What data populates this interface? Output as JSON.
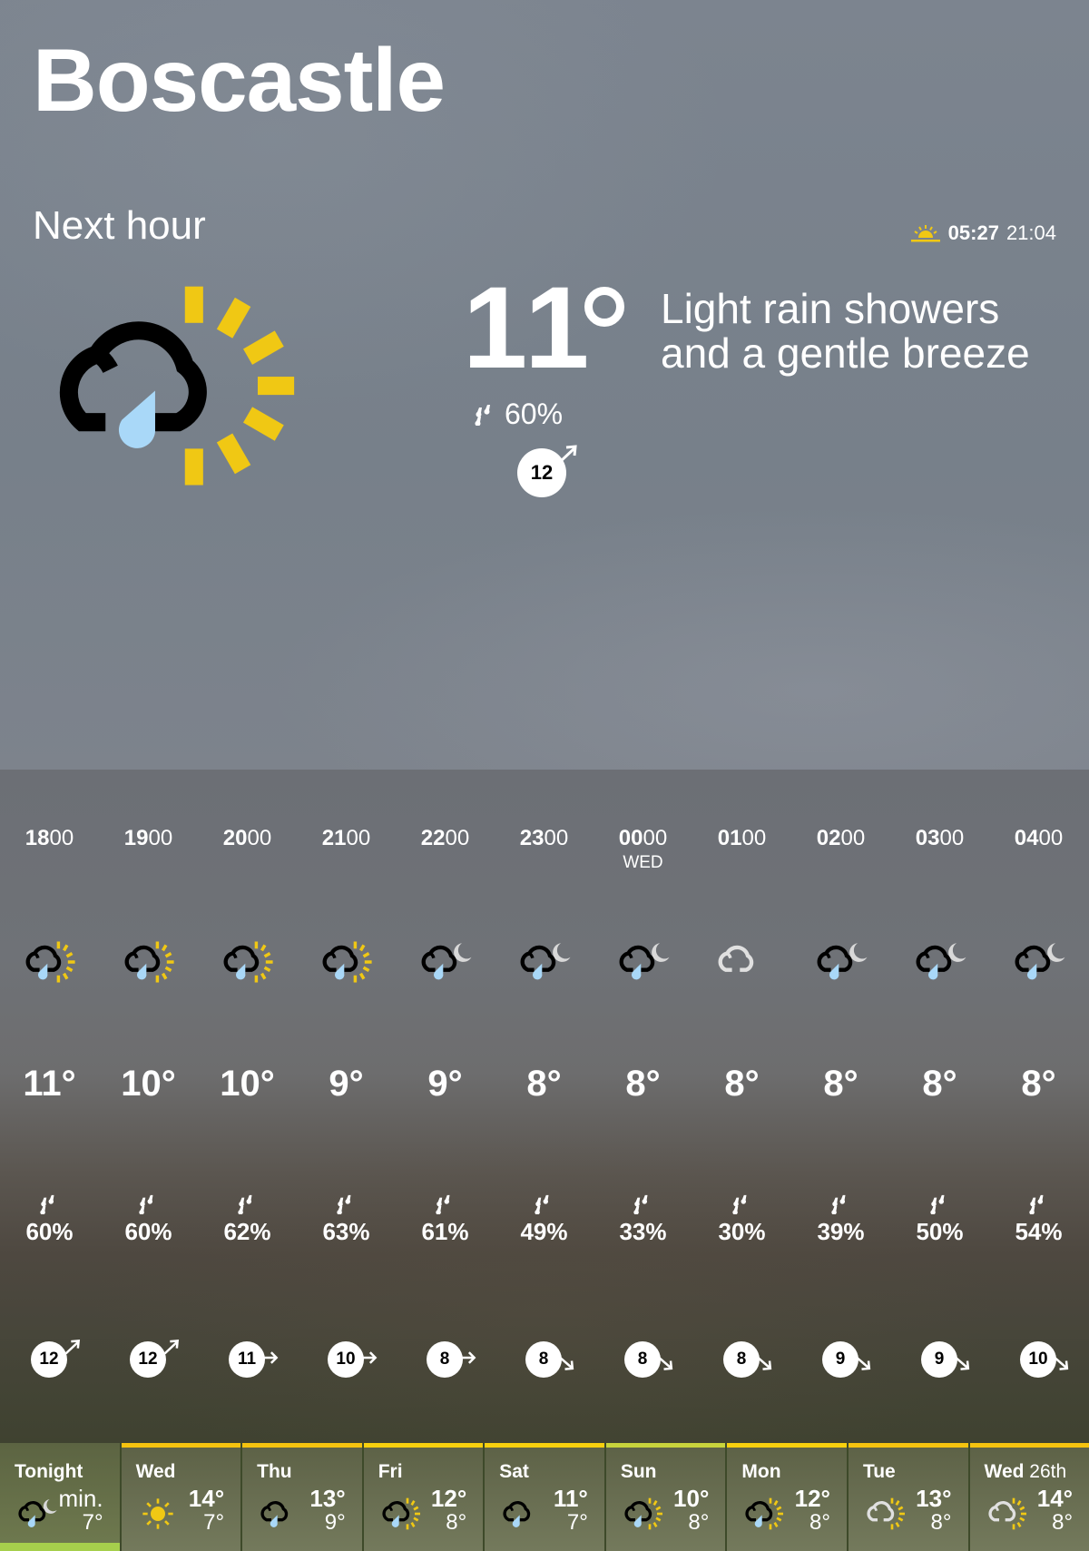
{
  "location": "Boscastle",
  "next_hour": {
    "label": "Next hour",
    "icon": "light-rain-shower-day-icon",
    "temperature": "11",
    "description_line1": "Light rain showers",
    "description_line2": "and a gentle breeze",
    "rain_chance": "60%",
    "wind_speed": "12",
    "wind_direction": "south-west"
  },
  "sun": {
    "icon": "sunrise-icon",
    "sunrise": "05:27",
    "sunset": "21:04"
  },
  "hourly": [
    {
      "hour": "18",
      "min": "00",
      "day": "",
      "icon": "light-rain-shower-day-icon",
      "temp": "11°",
      "rain": "60%",
      "wind": "12",
      "dir": "sw"
    },
    {
      "hour": "19",
      "min": "00",
      "day": "",
      "icon": "light-rain-shower-day-icon",
      "temp": "10°",
      "rain": "60%",
      "wind": "12",
      "dir": "sw"
    },
    {
      "hour": "20",
      "min": "00",
      "day": "",
      "icon": "light-rain-shower-day-icon",
      "temp": "10°",
      "rain": "62%",
      "wind": "11",
      "dir": "w"
    },
    {
      "hour": "21",
      "min": "00",
      "day": "",
      "icon": "light-rain-shower-day-icon",
      "temp": "9°",
      "rain": "63%",
      "wind": "10",
      "dir": "w"
    },
    {
      "hour": "22",
      "min": "00",
      "day": "",
      "icon": "light-rain-shower-night-icon",
      "temp": "9°",
      "rain": "61%",
      "wind": "8",
      "dir": "w"
    },
    {
      "hour": "23",
      "min": "00",
      "day": "",
      "icon": "light-rain-shower-night-icon",
      "temp": "8°",
      "rain": "49%",
      "wind": "8",
      "dir": "nw"
    },
    {
      "hour": "00",
      "min": "00",
      "day": "WED",
      "icon": "light-rain-shower-night-icon",
      "temp": "8°",
      "rain": "33%",
      "wind": "8",
      "dir": "nw"
    },
    {
      "hour": "01",
      "min": "00",
      "day": "",
      "icon": "light-cloud-icon",
      "temp": "8°",
      "rain": "30%",
      "wind": "8",
      "dir": "nw"
    },
    {
      "hour": "02",
      "min": "00",
      "day": "",
      "icon": "light-rain-shower-night-icon",
      "temp": "8°",
      "rain": "39%",
      "wind": "9",
      "dir": "nw"
    },
    {
      "hour": "03",
      "min": "00",
      "day": "",
      "icon": "light-rain-shower-night-icon",
      "temp": "8°",
      "rain": "50%",
      "wind": "9",
      "dir": "nw"
    },
    {
      "hour": "04",
      "min": "00",
      "day": "",
      "icon": "light-rain-shower-night-icon",
      "temp": "8°",
      "rain": "54%",
      "wind": "10",
      "dir": "nw"
    }
  ],
  "daily": [
    {
      "name": "Tonight",
      "suffix": "",
      "icon": "light-rain-shower-night-icon",
      "hi": "",
      "min_label": "min.",
      "lo": "7°",
      "bar": "#a6cf4c",
      "bar_pos": "bottom"
    },
    {
      "name": "Wed",
      "suffix": "",
      "icon": "sunny-icon",
      "hi": "14°",
      "lo": "7°",
      "bar": "#f5c30f"
    },
    {
      "name": "Thu",
      "suffix": "",
      "icon": "light-rain-icon",
      "hi": "13°",
      "lo": "9°",
      "bar": "#f5c30f"
    },
    {
      "name": "Fri",
      "suffix": "",
      "icon": "light-rain-shower-day-icon",
      "hi": "12°",
      "lo": "8°",
      "bar": "#f7d00e"
    },
    {
      "name": "Sat",
      "suffix": "",
      "icon": "light-rain-icon",
      "hi": "11°",
      "lo": "7°",
      "bar": "#f7d00e"
    },
    {
      "name": "Sun",
      "suffix": "",
      "icon": "light-rain-shower-day-icon",
      "hi": "10°",
      "lo": "8°",
      "bar": "#c8d43c"
    },
    {
      "name": "Mon",
      "suffix": "",
      "icon": "light-rain-shower-day-icon",
      "hi": "12°",
      "lo": "8°",
      "bar": "#f7d00e"
    },
    {
      "name": "Tue",
      "suffix": "",
      "icon": "sunny-intervals-icon",
      "hi": "13°",
      "lo": "8°",
      "bar": "#f5c30f"
    },
    {
      "name": "Wed",
      "suffix": "26th",
      "icon": "sunny-intervals-icon",
      "hi": "14°",
      "lo": "8°",
      "bar": "#f5c30f"
    }
  ],
  "colors": {
    "sun": "#f0c814",
    "rain_drop": "#a9d8f8",
    "cloud": "#000000",
    "moon": "#d8d8d8",
    "light_cloud": "#e0e0e0"
  }
}
